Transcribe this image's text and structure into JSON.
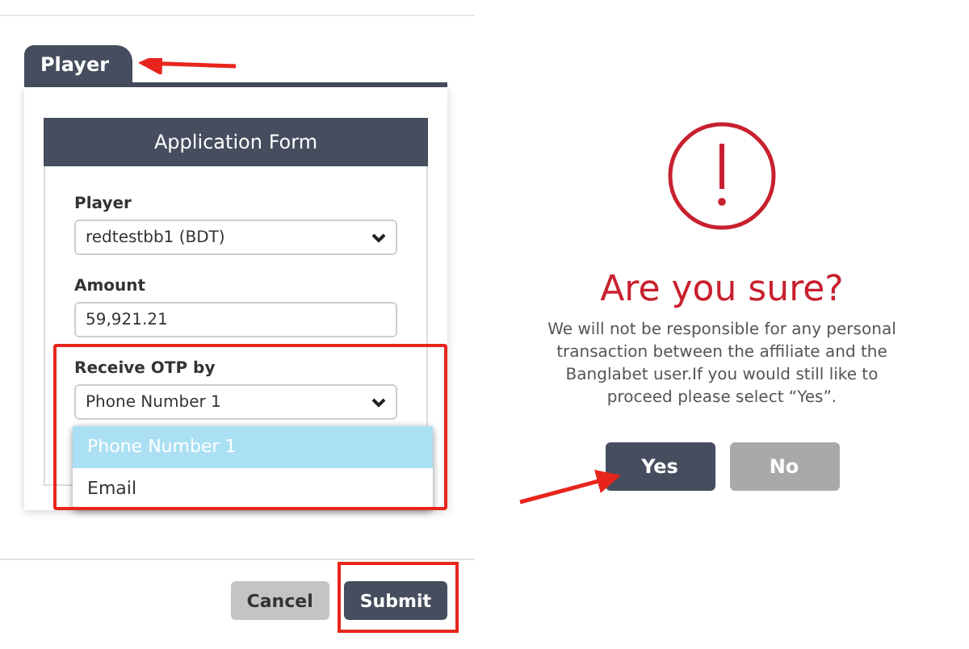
{
  "tabs": [
    {
      "label": "Player",
      "selected": true
    }
  ],
  "form": {
    "title": "Application Form",
    "fields": [
      {
        "kind": "select",
        "label": "Player",
        "value": "redtestbb1 (BDT)"
      },
      {
        "kind": "input",
        "label": "Amount",
        "value": "59,921.21"
      },
      {
        "kind": "select",
        "label": "Receive OTP by",
        "value": "Phone Number 1",
        "expanded": true,
        "options": [
          {
            "label": "Phone Number 1",
            "selected": true
          },
          {
            "label": "Email",
            "selected": false
          }
        ]
      }
    ]
  },
  "buttons": [
    {
      "label": "Cancel",
      "kind": "secondary"
    },
    {
      "label": "Submit",
      "kind": "primary"
    }
  ],
  "dialog": {
    "title": "Are you sure?",
    "message": "We will not be responsible for any personal transaction between the affiliate and the Banglabet user.If you would still like to proceed please select “Yes”.",
    "buttons": [
      {
        "label": "Yes",
        "kind": "confirm"
      },
      {
        "label": "No",
        "kind": "cancel"
      }
    ]
  }
}
